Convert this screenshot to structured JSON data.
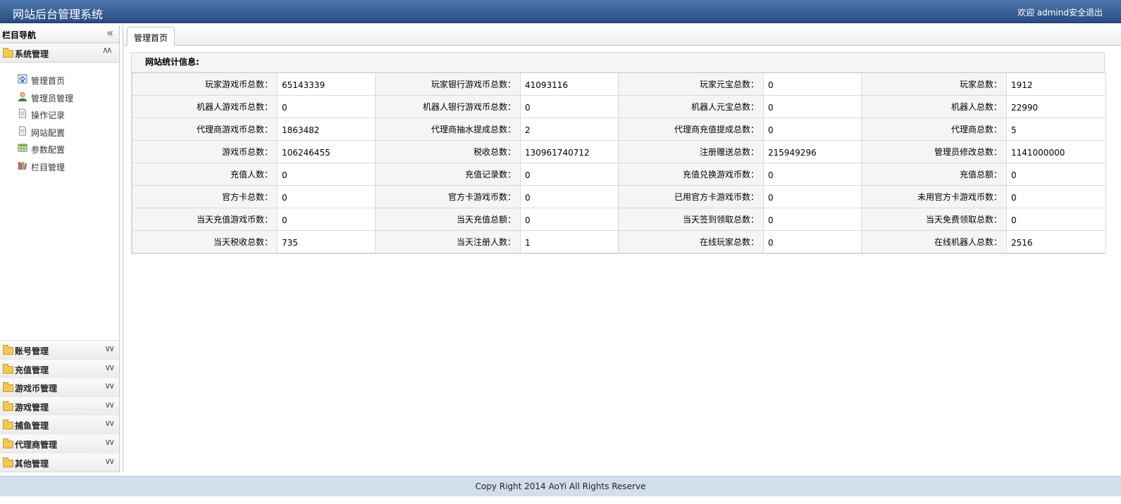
{
  "header": {
    "title": "网站后台管理系统",
    "welcome_prefix": "欢迎 ",
    "user": "admind",
    "logout": "安全退出"
  },
  "sidebar": {
    "title": "栏目导航",
    "collapse_symbol": "«",
    "expanded_group": {
      "label": "系统管理",
      "items": [
        {
          "label": "管理首页",
          "icon": "home-icon"
        },
        {
          "label": "管理员管理",
          "icon": "user-icon"
        },
        {
          "label": "操作记录",
          "icon": "document-icon"
        },
        {
          "label": "网站配置",
          "icon": "document-icon"
        },
        {
          "label": "参数配置",
          "icon": "table-icon"
        },
        {
          "label": "栏目管理",
          "icon": "books-icon"
        }
      ]
    },
    "groups": [
      {
        "label": "账号管理"
      },
      {
        "label": "充值管理"
      },
      {
        "label": "游戏币管理"
      },
      {
        "label": "游戏管理"
      },
      {
        "label": "捕鱼管理"
      },
      {
        "label": "代理商管理"
      },
      {
        "label": "其他管理"
      }
    ]
  },
  "tabs": [
    {
      "label": "管理首页"
    }
  ],
  "stats": {
    "title": "网站统计信息:",
    "rows": [
      [
        [
          "玩家游戏币总数：",
          "65143339"
        ],
        [
          "玩家银行游戏币总数：",
          "41093116"
        ],
        [
          "玩家元宝总数：",
          "0"
        ],
        [
          "玩家总数：",
          "1912"
        ]
      ],
      [
        [
          "机器人游戏币总数：",
          "0"
        ],
        [
          "机器人银行游戏币总数：",
          "0"
        ],
        [
          "机器人元宝总数：",
          "0"
        ],
        [
          "机器人总数：",
          "22990"
        ]
      ],
      [
        [
          "代理商游戏币总数：",
          "1863482"
        ],
        [
          "代理商抽水提成总数：",
          "2"
        ],
        [
          "代理商充值提成总数：",
          "0"
        ],
        [
          "代理商总数：",
          "5"
        ]
      ],
      [
        [
          "游戏币总数：",
          "106246455"
        ],
        [
          "税收总数：",
          "130961740712"
        ],
        [
          "注册赠送总数：",
          "215949296"
        ],
        [
          "管理员修改总数：",
          "1141000000"
        ]
      ],
      [
        [
          "充值人数：",
          "0"
        ],
        [
          "充值记录数：",
          "0"
        ],
        [
          "充值兑换游戏币数：",
          "0"
        ],
        [
          "充值总额：",
          "0"
        ]
      ],
      [
        [
          "官方卡总数：",
          "0"
        ],
        [
          "官方卡游戏币数：",
          "0"
        ],
        [
          "已用官方卡游戏币数：",
          "0"
        ],
        [
          "未用官方卡游戏币数：",
          "0"
        ]
      ],
      [
        [
          "当天充值游戏币数：",
          "0"
        ],
        [
          "当天充值总额：",
          "0"
        ],
        [
          "当天签到领取总数：",
          "0"
        ],
        [
          "当天免费领取总数：",
          "0"
        ]
      ],
      [
        [
          "当天税收总数：",
          "735"
        ],
        [
          "当天注册人数：",
          "1"
        ],
        [
          "在线玩家总数：",
          "0"
        ],
        [
          "在线机器人总数：",
          "2516"
        ]
      ]
    ]
  },
  "footer": {
    "text": "Copy Right 2014 AoYi All Rights Reserve"
  },
  "colors": {
    "header": "#2a4c82",
    "footer": "#d3deed"
  }
}
